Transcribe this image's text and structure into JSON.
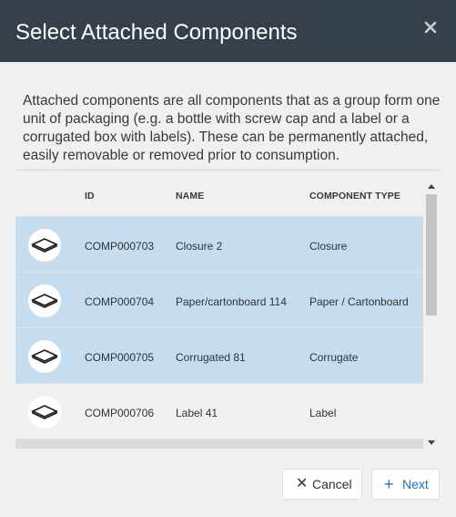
{
  "dialog": {
    "title": "Select Attached Components",
    "close_glyph": "✕",
    "description": "Attached components are all components that as a group form one unit of packaging (e.g. a bottle with screw cap and a label or a corrugated box with labels). These can be permanently attached, easily removable or removed prior to consumption."
  },
  "table": {
    "columns": [
      "",
      "ID",
      "NAME",
      "COMPONENT TYPE"
    ],
    "rows": [
      {
        "icon": "package-diamond-icon",
        "id": "COMP000703",
        "name": "Closure 2",
        "type": "Closure",
        "selected": true
      },
      {
        "icon": "package-diamond-icon",
        "id": "COMP000704",
        "name": "Paper/cartonboard 114",
        "type": "Paper / Cartonboard",
        "selected": true
      },
      {
        "icon": "package-diamond-icon",
        "id": "COMP000705",
        "name": "Corrugated 81",
        "type": "Corrugate",
        "selected": true
      },
      {
        "icon": "package-diamond-icon",
        "id": "COMP000706",
        "name": "Label 41",
        "type": "Label",
        "selected": false
      }
    ]
  },
  "buttons": {
    "cancel": {
      "glyph": "✕",
      "label": "Cancel"
    },
    "next": {
      "glyph": "+",
      "label": "Next"
    }
  },
  "colors": {
    "header_bg": "#36404a",
    "selected_row": "#c6ddf0",
    "accent": "#1a73c8"
  }
}
